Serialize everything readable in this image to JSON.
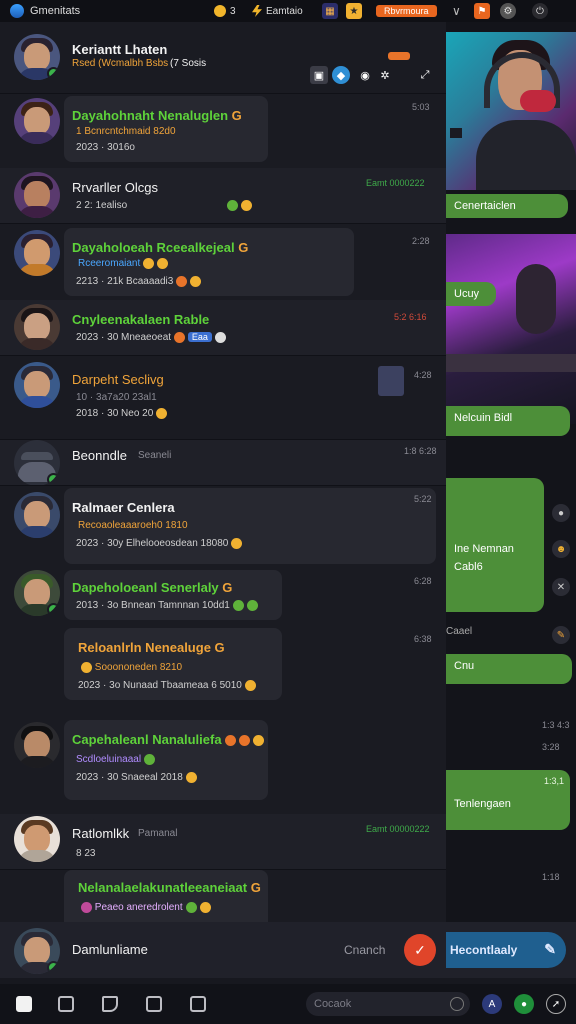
{
  "topbar": {
    "app_name": "Gmenitats",
    "coins": "3",
    "section": "Eamtaio",
    "cta": "Rbvrmoura",
    "icons": [
      "calendar-icon",
      "badge-icon",
      "chevron-icon",
      "flag-icon",
      "settings-icon",
      "power-icon"
    ]
  },
  "header": {
    "name": "Keriantt Lhaten",
    "sub": "Rsed (Wcmalbh Bsbs",
    "sub_extra": "(7 Sosis"
  },
  "chats": [
    {
      "name": "Dayahohnaht Nenaluglen",
      "meta": "1 Bcnrcntchmaid 82d0",
      "line2": "2023 · 3016o",
      "time": "5:03"
    },
    {
      "name": "Rrvarller Olcgs",
      "meta": "2 2: 1ealiso",
      "time": "Eamt 0000222"
    },
    {
      "name": "Dayaholoeah Rceealkejeal",
      "meta": "Rceeromaiant",
      "line2": "2213 · 21k Bcaaaadi3",
      "time": "2:28"
    },
    {
      "name": "Cnyleenakalaen Rable",
      "meta": "2023 · 30 Mneaeoeat",
      "time": "5:2 6:16",
      "tag": "Eaa"
    },
    {
      "name": "Darpeht Seclivg",
      "meta": "10 · 3a7a20 23al1",
      "line2": "2018 · 30 Neo 20",
      "time": "4:28"
    },
    {
      "name": "Beonndle",
      "sub": "Seaneli",
      "time": "1:8 6:28"
    },
    {
      "name": "Ralmaer Cenlera",
      "meta": "Recoaoleaaaroeh0 1810",
      "line2": "2023 · 30y Elhelooeosdean 18080",
      "time": "5:22"
    },
    {
      "name": "Dapeholoeanl Senerlaly",
      "meta": "2013 · 3o Bnnean Tamnnan 10dd1",
      "time": "6:28"
    },
    {
      "name": "Reloanlrln Nenealuge",
      "meta": "Sooononeden 8210",
      "line2": "2023 · 3o Nunaad Tbaameaa 6 5010",
      "time": "6:38"
    },
    {
      "name": "Capehaleanl Nanaluliefa",
      "meta": "Scdloeluinaaal",
      "line2": "2023 · 30 Snaeeal 2018",
      "time": ""
    },
    {
      "name": "Ratlomlkk",
      "sub": "Pamanal",
      "line2": "8 23",
      "time": "Eamt 00000222"
    },
    {
      "name": "Nelanalaelakunatleeaneiaat",
      "meta": "Peaeo aneredrolent",
      "time": ""
    }
  ],
  "right_panel": {
    "messages": [
      "Cenertaiclen",
      "Ucuy",
      "Nelcuin Bidl",
      "Ine Nemnan",
      "Cabl6",
      "Caael",
      "Cnu",
      "Tenlengaen",
      "Hecontlaaly"
    ],
    "times": [
      "1:3 4:3",
      "3:28",
      "1:3,1",
      "1:18"
    ]
  },
  "compose": {
    "name": "Damlunliame",
    "search": "Cnanch"
  },
  "nav": {
    "search_placeholder": "Cocaok"
  }
}
